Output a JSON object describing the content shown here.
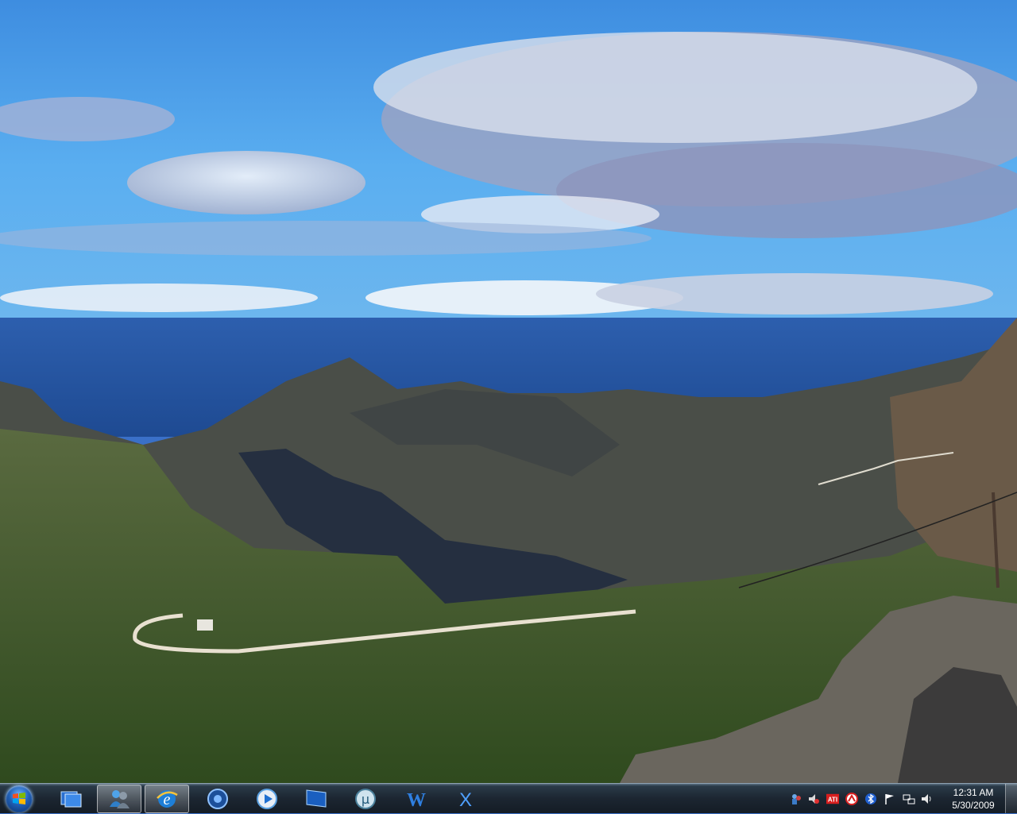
{
  "taskbar": {
    "start_button": {
      "icon": "windows-logo-icon"
    },
    "pinned": [
      {
        "name": "taskbar-item-window-switcher",
        "icon": "switch-windows-icon",
        "active": false
      },
      {
        "name": "taskbar-item-messenger",
        "icon": "messenger-icon",
        "active": true
      },
      {
        "name": "taskbar-item-internet-explorer",
        "icon": "internet-explorer-icon",
        "active": true
      },
      {
        "name": "taskbar-item-media-center",
        "icon": "media-center-icon",
        "active": false
      },
      {
        "name": "taskbar-item-media-player",
        "icon": "media-player-icon",
        "active": false
      },
      {
        "name": "taskbar-item-screen-app",
        "icon": "monitor-icon",
        "active": false
      },
      {
        "name": "taskbar-item-utorrent",
        "icon": "utorrent-icon",
        "active": false
      },
      {
        "name": "taskbar-item-word",
        "icon": "word-icon",
        "active": false
      },
      {
        "name": "taskbar-item-x-app",
        "icon": "x-app-icon",
        "active": false
      }
    ],
    "tray_icons": [
      "network-people-icon",
      "volume-mute-icon",
      "ati-icon",
      "antivirus-icon",
      "bluetooth-icon",
      "action-center-flag-icon",
      "network-icon",
      "speaker-icon"
    ],
    "clock": {
      "time": "12:31 AM",
      "date": "5/30/2009"
    }
  },
  "colors": {
    "taskbar": "#1c2631",
    "sky": "#3d8fe0",
    "sea": "#2a5aa8",
    "mountain": "#4a4e48",
    "vegetation": "#4f6a32"
  }
}
